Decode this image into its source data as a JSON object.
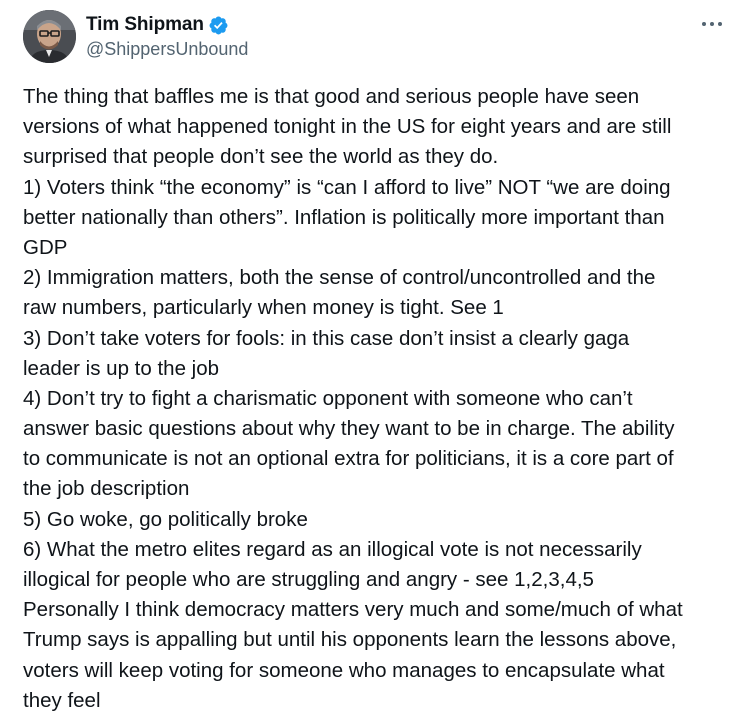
{
  "author": {
    "display_name": "Tim Shipman",
    "handle": "@ShippersUnbound",
    "verified": true,
    "avatar_icon": "user-avatar-photo"
  },
  "actions": {
    "more_icon": "more-horizontal-icon"
  },
  "colors": {
    "text_primary": "#0f1419",
    "text_secondary": "#536471",
    "verified_blue": "#1d9bf0"
  },
  "tweet_lines": [
    "The thing that baffles me is that good and serious people have seen",
    "versions of what happened tonight in the US for eight years and are still",
    "surprised that people don’t see the world as they do.",
    "1) Voters think “the economy” is “can I afford to live” NOT “we are doing",
    "better nationally than others”. Inflation is politically more important than",
    "GDP",
    "2) Immigration matters, both the sense of control/uncontrolled and the",
    "raw numbers, particularly when money is tight. See 1",
    "3) Don’t take voters for fools: in this case don’t insist a clearly gaga",
    "leader is up to the job",
    "4) Don’t try to fight a charismatic opponent with someone who can’t",
    "answer basic questions about why they want to be in charge. The ability",
    "to communicate is not an optional extra for politicians, it is a core part of",
    "the job description",
    "5) Go woke, go politically broke",
    "6) What the metro elites regard as an illogical vote is not necessarily",
    "illogical for people who are struggling and angry - see 1,2,3,4,5",
    "Personally I think democracy matters very much and some/much of what",
    "Trump says is appalling but until his opponents learn the lessons above,",
    "voters will keep voting for someone who manages to encapsulate what",
    "they feel"
  ]
}
